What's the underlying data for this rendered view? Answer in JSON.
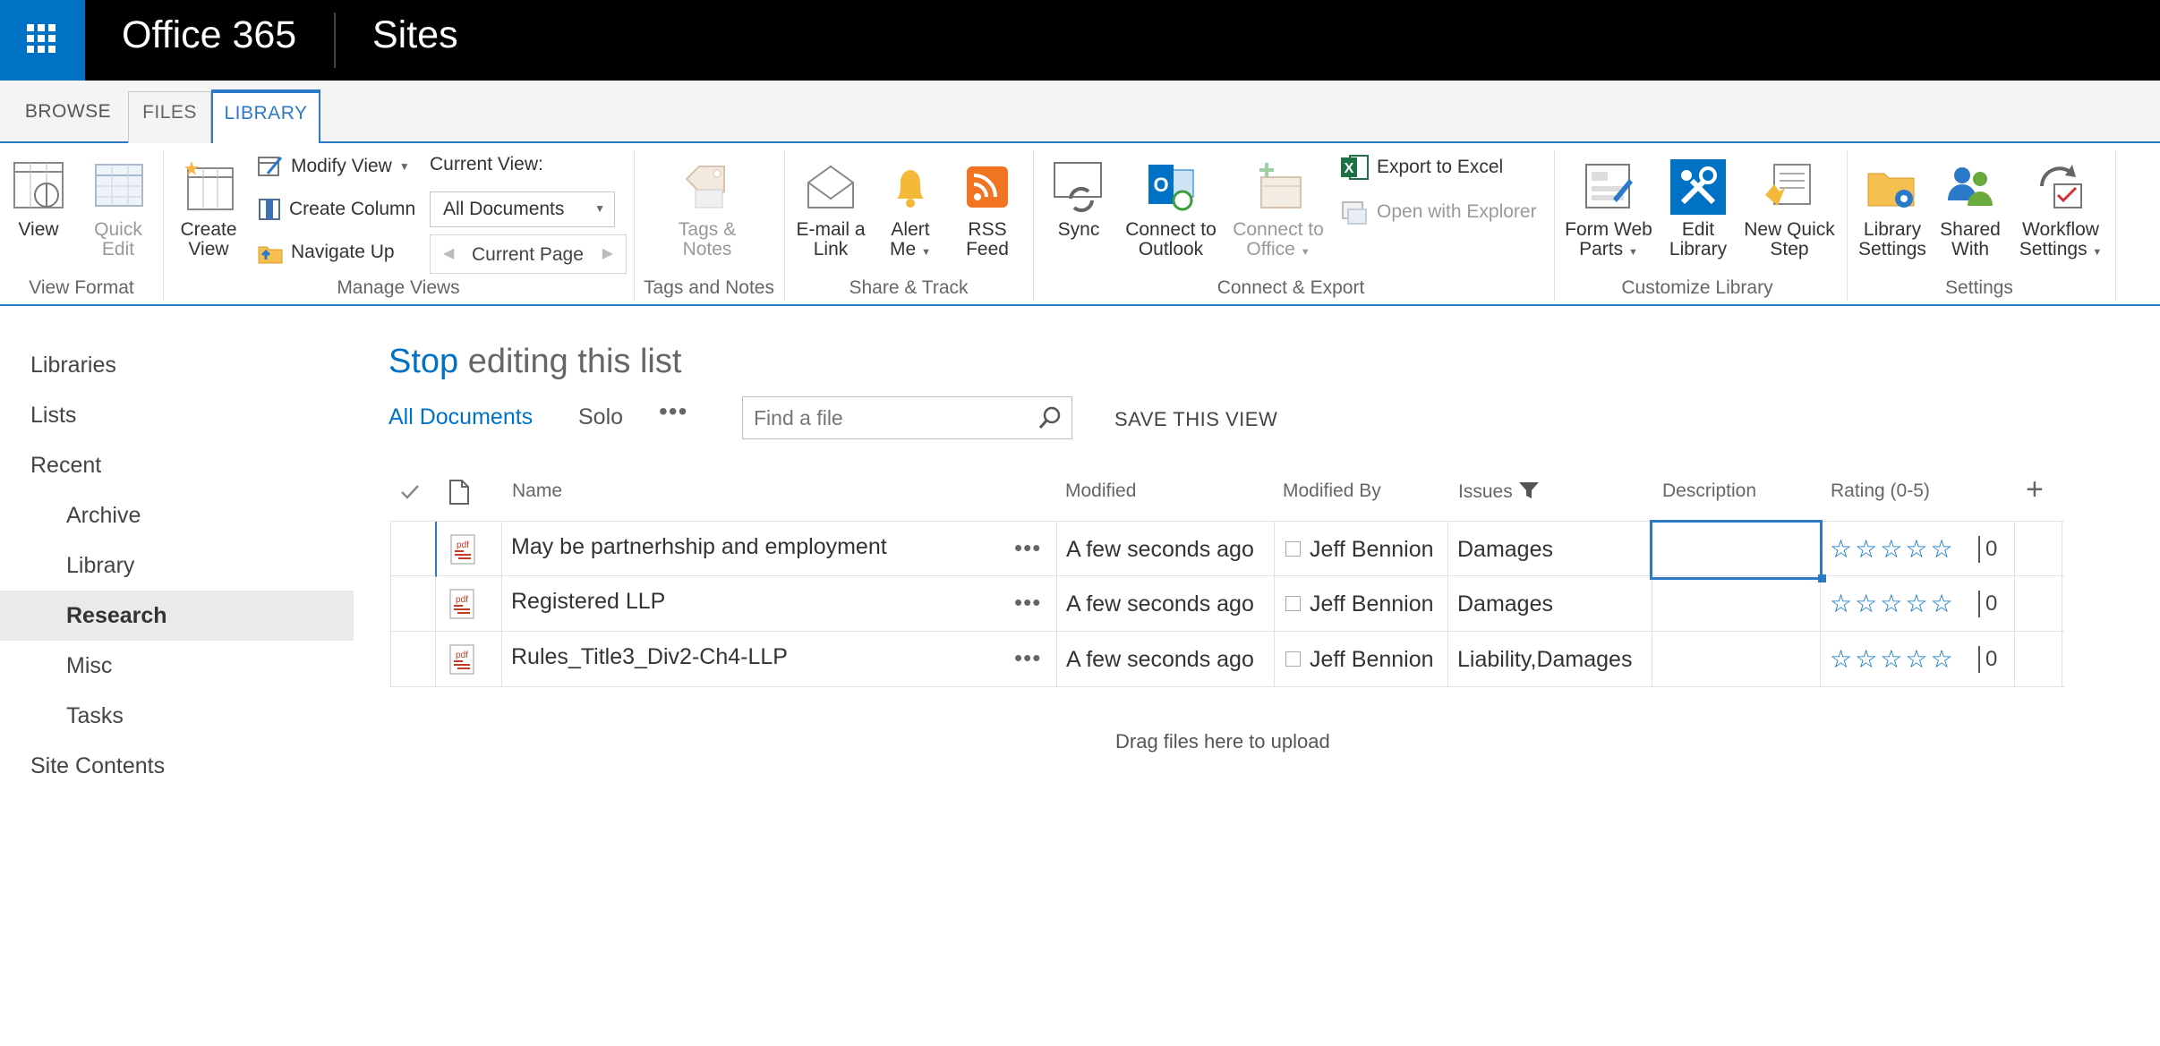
{
  "suite": {
    "brand": "Office 365",
    "site": "Sites"
  },
  "tabs": [
    {
      "label": "BROWSE"
    },
    {
      "label": "FILES"
    },
    {
      "label": "LIBRARY",
      "selected": true
    }
  ],
  "ribbon": {
    "view_format": {
      "label": "View Format",
      "view": "View",
      "quick_edit": [
        "Quick",
        "Edit"
      ]
    },
    "manage_views": {
      "label": "Manage Views",
      "create_view": [
        "Create",
        "View"
      ],
      "modify_view": "Modify View",
      "create_column": "Create Column",
      "navigate_up": "Navigate Up",
      "current_view_label": "Current View:",
      "current_view_value": "All Documents",
      "current_page": "Current Page"
    },
    "tags_notes": {
      "label": "Tags and Notes",
      "button": [
        "Tags &",
        "Notes"
      ]
    },
    "share_track": {
      "label": "Share & Track",
      "email": [
        "E-mail a",
        "Link"
      ],
      "alert": [
        "Alert",
        "Me"
      ],
      "rss": [
        "RSS",
        "Feed"
      ]
    },
    "connect_export": {
      "label": "Connect & Export",
      "sync": "Sync",
      "outlook": [
        "Connect to",
        "Outlook"
      ],
      "office": [
        "Connect to",
        "Office"
      ],
      "export_excel": "Export to Excel",
      "open_explorer": "Open with Explorer"
    },
    "customize": {
      "label": "Customize Library",
      "form_web_parts": [
        "Form Web",
        "Parts"
      ],
      "edit_library": [
        "Edit",
        "Library"
      ],
      "new_quick_step": [
        "New Quick",
        "Step"
      ]
    },
    "settings": {
      "label": "Settings",
      "library_settings": [
        "Library",
        "Settings"
      ],
      "shared_with": [
        "Shared",
        "With"
      ],
      "workflow_settings": [
        "Workflow",
        "Settings"
      ]
    }
  },
  "nav": {
    "items": [
      {
        "label": "Libraries"
      },
      {
        "label": "Lists"
      },
      {
        "label": "Recent"
      },
      {
        "label": "Archive"
      },
      {
        "label": "Library"
      },
      {
        "label": "Research"
      },
      {
        "label": "Misc"
      },
      {
        "label": "Tasks"
      },
      {
        "label": "Site Contents"
      }
    ]
  },
  "main": {
    "title_stop": "Stop",
    "title_rest": " editing this list",
    "view_all": "All Documents",
    "view_solo": "Solo",
    "more": "•••",
    "search_placeholder": "Find a file",
    "save_view": "SAVE THIS VIEW",
    "drag_text": "Drag files here to upload",
    "add_column": "+"
  },
  "columns": {
    "name": "Name",
    "modified": "Modified",
    "modified_by": "Modified By",
    "issues": "Issues",
    "description": "Description",
    "rating": "Rating (0-5)"
  },
  "rows": [
    {
      "name": "May be partnerhship and employment",
      "modified": "A few seconds ago",
      "modified_by": "Jeff Bennion",
      "issues": "Damages",
      "description": "",
      "rating": "0"
    },
    {
      "name": "Registered LLP",
      "modified": "A few seconds ago",
      "modified_by": "Jeff Bennion",
      "issues": "Damages",
      "description": "",
      "rating": "0"
    },
    {
      "name": "Rules_Title3_Div2-Ch4-LLP",
      "modified": "A few seconds ago",
      "modified_by": "Jeff Bennion",
      "issues": "Liability,Damages",
      "description": "",
      "rating": "0"
    }
  ],
  "colors": {
    "accent": "#0072c6",
    "ribbon_line": "#2b79c9",
    "suite_bg": "#000000"
  }
}
